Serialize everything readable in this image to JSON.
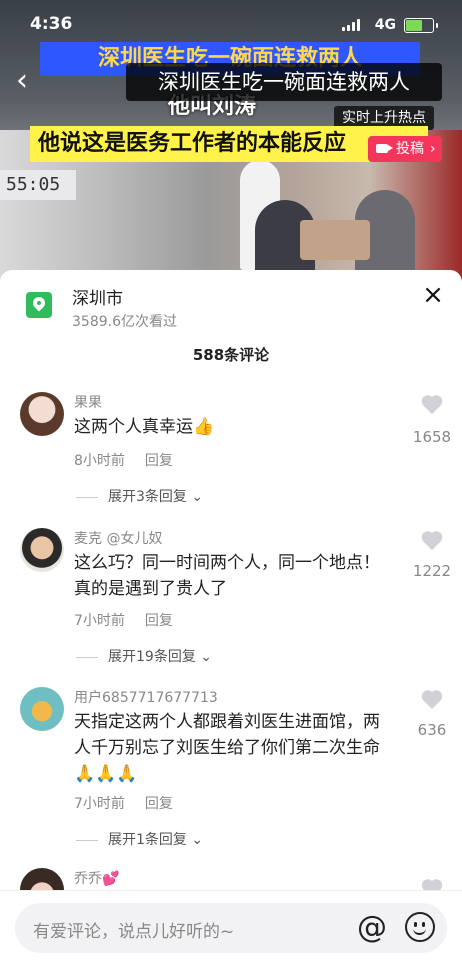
{
  "status_bar": {
    "time": "4:36",
    "network": "4G"
  },
  "video": {
    "title": "深圳医生吃一碗面连救两人",
    "overlay_title": "深圳医生吃一碗面连救两人",
    "overlay_line2": "他叫刘涛",
    "hot_badge": "实时上升热点",
    "caption": "他说这是医务工作者的本能反应",
    "post_button": "投稿",
    "post_arrow": "›",
    "clock_text": "55:05"
  },
  "panel": {
    "location_name": "深圳市",
    "location_views": "3589.6亿次看过",
    "close_icon": "×",
    "comment_count": "588条评论"
  },
  "comments": [
    {
      "user": "果果",
      "text": "这两个人真幸运👍",
      "time": "8小时前",
      "reply": "回复",
      "likes": "1658",
      "expand": "展开3条回复"
    },
    {
      "user": "麦克 @女儿奴",
      "text": "这么巧？同一时间两个人，同一个地点！真的是遇到了贵人了",
      "time": "7小时前",
      "reply": "回复",
      "likes": "1222",
      "expand": "展开19条回复"
    },
    {
      "user": "用户6857717677713",
      "text": "天指定这两个人都跟着刘医生进面馆，两人千万别忘了刘医生给了你们第二次生命🙏🙏🙏",
      "time": "7小时前",
      "reply": "回复",
      "likes": "636",
      "expand": "展开1条回复"
    },
    {
      "user": "乔乔💕",
      "text": "",
      "time": "",
      "reply": "",
      "likes": "",
      "expand": ""
    }
  ],
  "input": {
    "placeholder": "有爱评论，说点儿好听的~",
    "at_icon": "@"
  },
  "colors": {
    "accent": "#f5365c",
    "location": "#2ebd5a",
    "caption_bg": "#fff34b"
  }
}
